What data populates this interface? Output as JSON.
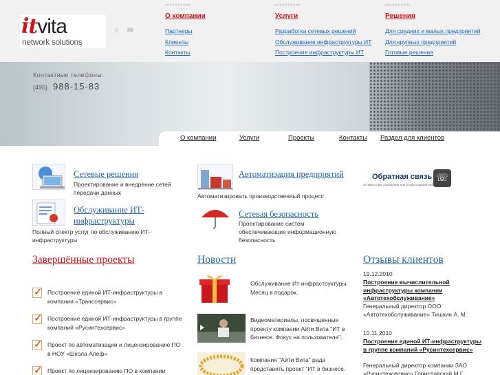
{
  "logo": {
    "it": "it",
    "vita": "vita",
    "sub": "network solutions"
  },
  "header_icons": [
    "home-icon",
    "mail-icon"
  ],
  "nav": [
    {
      "head": "О компании",
      "links": [
        "Партнеры",
        "Клиенты",
        "Контакты"
      ]
    },
    {
      "head": "Услуги",
      "links": [
        "Разработка сетевых решений",
        "Обслуживание инфраструктуры ИТ",
        "Построение инфраструктуры ИТ"
      ]
    },
    {
      "head": "Решения",
      "links": [
        "Для средних и малых предприятий",
        "Для крупных предприятий",
        "Готовые решения"
      ]
    }
  ],
  "contacts": {
    "label": "Контактные телефоны:",
    "code": "(495)",
    "number": "988-15-83"
  },
  "tabs": [
    "О компании",
    "Услуги",
    "Проекты",
    "Контакты",
    "Раздел для клиентов"
  ],
  "services": [
    {
      "title": "Сетевые решения",
      "desc": "Проектирование и внедрение сетей передачи данных"
    },
    {
      "title": "Обслуживание ИТ-инфраструктуры",
      "desc": "Полный спектр услуг по обслуживанию ИТ-инфраструктуры"
    },
    {
      "title": "Автоматизация предприятий",
      "desc": "Автоматизировать производственный процесс"
    },
    {
      "title": "Сетевая безопасность",
      "desc": "Проектирование систем обеспечивающие информационную безопасность"
    }
  ],
  "feedback": {
    "title": "Обратная связь",
    "sub": "оставьте нам сообщение или отзыв о нашей работе"
  },
  "projects": {
    "heading": "Завершённые проекты",
    "items": [
      "Построение единой ИТ-инфраструктуры в компании «Транссервис»",
      "Построение единой ИТ-инфраструктуры в группе компаний «Русинтехсервис»",
      "Проект по автоматизации и лицензированию ПО в НОУ «Школа Алеф»",
      "Проект по лицензированию ПО в компании"
    ]
  },
  "news": {
    "heading": "Новости",
    "items": [
      "Обслуживание Ит-инфраструктуры. Месяц в подарок.",
      "Видеоматериалы, посвященные проекту компании Айти Вита \"ИТ в бизнесе. Фокус на пользователе\".",
      "Компания \"Айти Вита\" рада представить проект \"ИТ в бизнесе."
    ]
  },
  "reviews": {
    "heading": "Отзывы клиентов",
    "items": [
      {
        "date": "19.12.2010",
        "link": "Построение вычислительной инфраструктуры компании «Автотехобслуживание»",
        "text": "Генеральный директор ООО «Автотехобслуживание» Тишкин А. М."
      },
      {
        "date": "10.11.2010",
        "link": "Построение единой ИТ-инфраструктуры в группе компаний «Русинтехсервис»",
        "text": "Генеральный директор компании ЗАО «Русинтехсервис» Гориславский М.Г."
      }
    ]
  },
  "colors": {
    "link": "#2464b4",
    "red_heading": "#c8171d",
    "teal_heading": "#2a6a96"
  }
}
